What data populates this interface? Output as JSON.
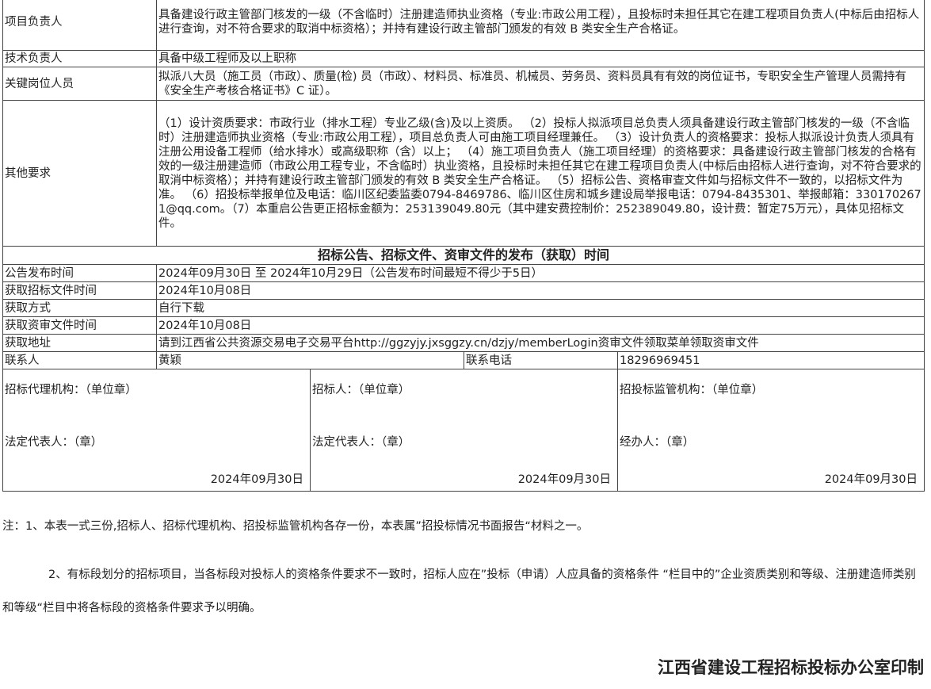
{
  "top_rows": [
    {
      "label": "项目负责人",
      "value": "具备建设行政主管部门核发的一级（不含临时）注册建造师执业资格（专业:市政公用工程），且投标时未担任其它在建工程项目负责人(中标后由招标人进行查询，对不符合要求的取消中标资格）；并持有建设行政主管部门颁发的有效 B 类安全生产合格证。"
    },
    {
      "label": "技术负责人",
      "value": "具备中级工程师及以上职称"
    },
    {
      "label": "关键岗位人员",
      "value": "拟派八大员（施工员（市政）、质量(检) 员（市政）、材料员、标准员、机械员、劳务员、资料员具有有效的岗位证书，专职安全生产管理人员需持有《安全生产考核合格证书》C 证）。"
    },
    {
      "label": "其他要求",
      "value": "（1）设计资质要求：市政行业（排水工程）专业乙级(含)及以上资质。 （2）投标人拟派项目总负责人须具备建设行政主管部门核发的一级（不含临时）注册建造师执业资格（专业:市政公用工程），项目总负责人可由施工项目经理兼任。 （3）设计负责人的资格要求：投标人拟派设计负责人须具有注册公用设备工程师（给水排水）或高级职称（含）以上； （4）施工项目负责人（施工项目经理）的资格要求：具备建设行政主管部门核发的合格有效的一级注册建造师（市政公用工程专业，不含临时）执业资格，且投标时未担任其它在建工程项目负责人(中标后由招标人进行查询，对不符合要求的取消中标资格）；并持有建设行政主管部门颁发的有效 B 类安全生产合格证。 （5）招标公告、资格审查文件如与招标文件不一致的，以招标文件为准。 （6）招投标举报单位及电话：临川区纪委监委0794-8469786、临川区住房和城乡建设局举报电话：0794-8435301、举报邮箱：3301702671@qq.com。（7）本重启公告更正招标金额为：253139049.80元（其中建安费控制价：252389049.80，设计费：暂定75万元），具体见招标文件。"
    }
  ],
  "section_title": "招标公告、招标文件、资审文件的发布（获取）时间",
  "info_rows": [
    {
      "label": "公告发布时间",
      "value": "2024年09月30日 至 2024年10月29日（公告发布时间最短不得少于5日）"
    },
    {
      "label": "获取招标文件时间",
      "value": "2024年10月08日"
    },
    {
      "label": "获取方式",
      "value": "自行下载"
    },
    {
      "label": "获取资审文件时间",
      "value": "2024年10月08日"
    },
    {
      "label": "获取地址",
      "value": "请到江西省公共资源交易电子交易平台http://ggzyjy.jxsggzy.cn/dzjy/memberLogin资审文件领取菜单领取资审文件"
    }
  ],
  "contact": {
    "label": "联系人",
    "name": "黄颖",
    "phone_label": "联系电话",
    "phone": "18296969451"
  },
  "signatures": [
    {
      "line1": "招标代理机构：（单位章）",
      "line2": "法定代表人：（章）",
      "date": "2024年09月30日"
    },
    {
      "line1": "招标人：（单位章）",
      "line2": "法定代表人：（章）",
      "date": "2024年09月30日"
    },
    {
      "line1": "招投标监管机构：（单位章）",
      "line2": "经办人：（章）",
      "date": "2024年09月30日"
    }
  ],
  "notes": {
    "note1": "注：1、本表一式三份,招标人、招标代理机构、招投标监管机构各存一份，本表属”招投标情况书面报告“材料之一。",
    "note2": "2、有标段划分的招标项目，当各标段对投标人的资格条件要求不一致时，招标人应在”投标（申请）人应具备的资格条件 “栏目中的”企业资质类别和等级、注册建造师类别和等级“栏目中将各标段的资格条件要求予以明确。"
  },
  "footer": "江西省建设工程招标投标办公室印制"
}
